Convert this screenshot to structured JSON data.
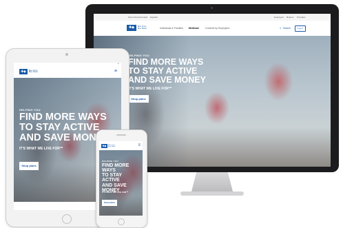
{
  "brand": {
    "name": "Blue Cross Blue Shield",
    "color": "#1a5ca8"
  },
  "hero": {
    "eyebrow": "HELPING YOU",
    "title_line1": "FIND MORE WAYS",
    "title_line2": "TO STAY ACTIVE",
    "title_line3": "AND SAVE MONEY",
    "tagline": "IT'S WHAT WE LIVE FOR℠",
    "cta": "Shop plans"
  },
  "desktop": {
    "topbar": [
      "Find a Doctor",
      "Contact",
      "Español"
    ],
    "topbar_right": [
      "Employers",
      "Brokers",
      "Providers"
    ],
    "nav": [
      "Individuals & Families",
      "Medicare",
      "Covered by Employers"
    ],
    "search": "Search",
    "login": "Log in"
  }
}
